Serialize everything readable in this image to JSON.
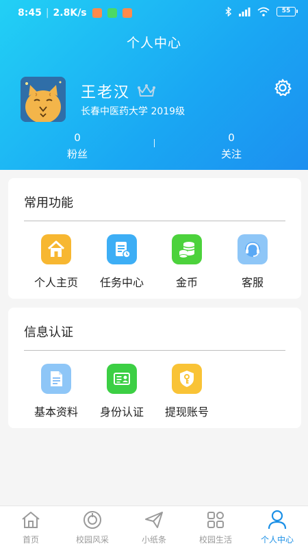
{
  "status_bar": {
    "time": "8:45",
    "speed": "2.8K/s",
    "battery": "55"
  },
  "header": {
    "title": "个人中心"
  },
  "profile": {
    "name": "王老汉",
    "school": "长春中医药大学 2019级"
  },
  "stats": {
    "fans_count": "0",
    "fans_label": "粉丝",
    "follow_count": "0",
    "follow_label": "关注"
  },
  "functions": {
    "title": "常用功能",
    "items": [
      {
        "label": "个人主页",
        "icon": "home-icon",
        "color": "#f7b731"
      },
      {
        "label": "任务中心",
        "icon": "task-icon",
        "color": "#3daef5"
      },
      {
        "label": "金币",
        "icon": "coins-icon",
        "color": "#4cd23c"
      },
      {
        "label": "客服",
        "icon": "headset-icon",
        "color": "#5aa9f5"
      }
    ]
  },
  "info": {
    "title": "信息认证",
    "items": [
      {
        "label": "基本资料",
        "icon": "document-icon",
        "color": "#78b7f7"
      },
      {
        "label": "身份认证",
        "icon": "id-card-icon",
        "color": "#3ccf44"
      },
      {
        "label": "提现账号",
        "icon": "shield-key-icon",
        "color": "#f9c336"
      }
    ]
  },
  "tabbar": {
    "items": [
      {
        "label": "首页",
        "icon": "home-outline-icon"
      },
      {
        "label": "校园风采",
        "icon": "campus-icon"
      },
      {
        "label": "小纸条",
        "icon": "paper-plane-icon"
      },
      {
        "label": "校园生活",
        "icon": "grid-icon"
      },
      {
        "label": "个人中心",
        "icon": "person-icon",
        "active": true
      }
    ]
  },
  "colors": {
    "accent": "#1a8fe6",
    "header_start": "#22d0f5",
    "header_end": "#1c8ff0"
  }
}
